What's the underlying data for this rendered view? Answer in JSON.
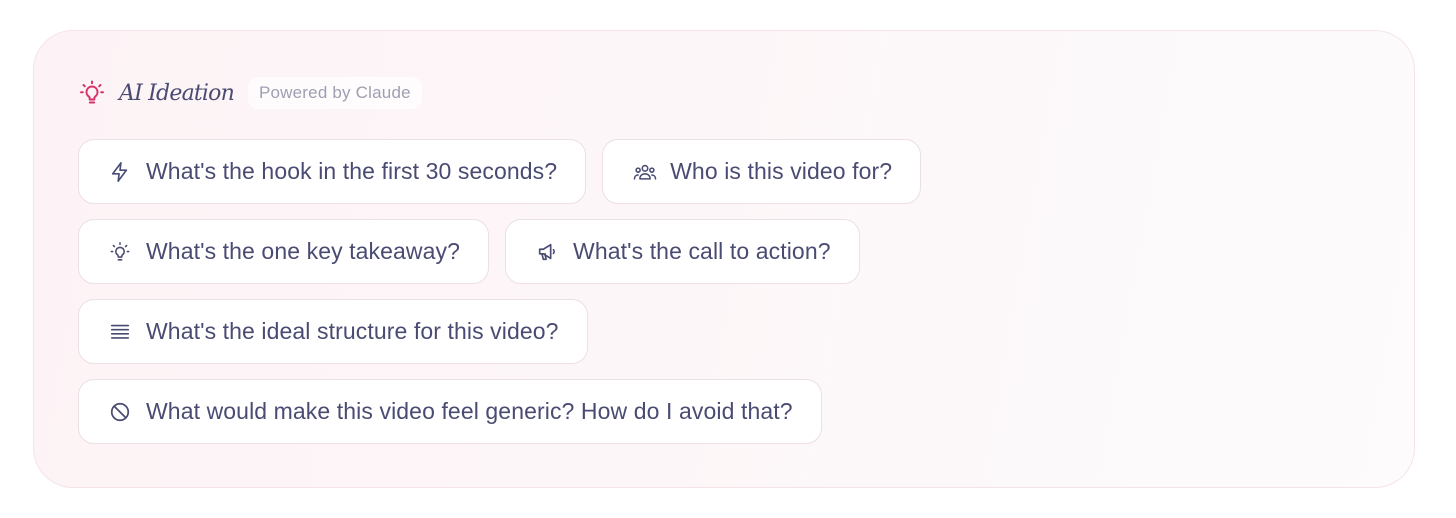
{
  "panel": {
    "title": "AI Ideation",
    "badge": "Powered by Claude",
    "title_icon": "lightbulb-icon",
    "accent_color": "#d6336c",
    "text_color": "#4a4b72"
  },
  "prompts": [
    {
      "icon": "bolt-icon",
      "label": "What's the hook in the first 30 seconds?"
    },
    {
      "icon": "users-icon",
      "label": "Who is this video for?"
    },
    {
      "icon": "lightbulb-icon",
      "label": "What's the one key takeaway?"
    },
    {
      "icon": "megaphone-icon",
      "label": "What's the call to action?"
    },
    {
      "icon": "list-lines-icon",
      "label": "What's the ideal structure for this video?"
    },
    {
      "icon": "ban-icon",
      "label": "What would make this video feel generic? How do I avoid that?"
    }
  ]
}
